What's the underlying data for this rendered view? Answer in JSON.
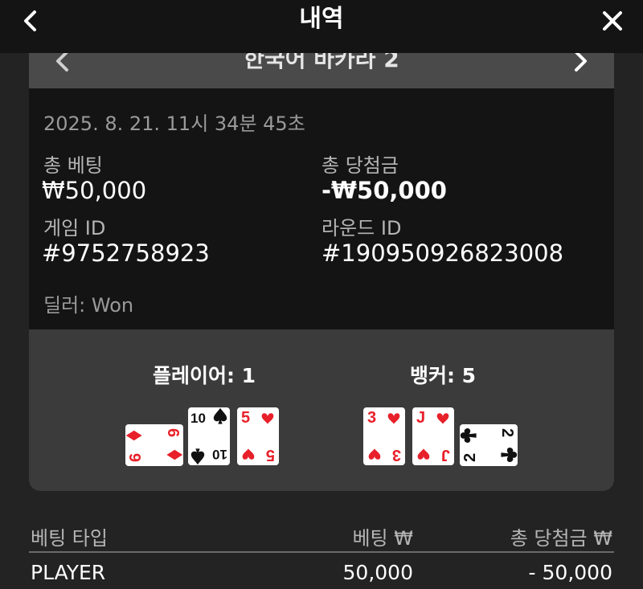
{
  "header": {
    "title": "내역",
    "back_icon": "chevron-left-icon",
    "close_icon": "close-icon"
  },
  "game_panel": {
    "game_name": "한국어 바카라 2",
    "prev_icon": "chevron-left-icon",
    "next_icon": "chevron-right-icon"
  },
  "details": {
    "timestamp": "2025. 8. 21. 11시 34분 45초",
    "total_bet_label": "총 베팅",
    "total_bet_value": "₩50,000",
    "total_win_label": "총 당첨금",
    "total_win_value": "-₩50,000",
    "game_id_label": "게임 ID",
    "game_id_value": "#9752758923",
    "round_id_label": "라운드 ID",
    "round_id_value": "#190950926823008",
    "dealer": "딜러: Won"
  },
  "result": {
    "player_label": "플레이어: 1",
    "banker_label": "뱅커: 5",
    "player_cards": [
      {
        "rank": "6",
        "suit": "diamond",
        "color": "#e8202a",
        "orientation": "side"
      },
      {
        "rank": "10",
        "suit": "spade",
        "color": "#111111",
        "orientation": "upright"
      },
      {
        "rank": "5",
        "suit": "heart",
        "color": "#e8202a",
        "orientation": "upright"
      }
    ],
    "banker_cards": [
      {
        "rank": "3",
        "suit": "heart",
        "color": "#e8202a",
        "orientation": "upright"
      },
      {
        "rank": "J",
        "suit": "heart",
        "color": "#e8202a",
        "orientation": "upright"
      },
      {
        "rank": "2",
        "suit": "club",
        "color": "#111111",
        "orientation": "side"
      }
    ]
  },
  "bets": {
    "columns": [
      "베팅 타입",
      "베팅 ₩",
      "총 당첨금 ₩"
    ],
    "rows": [
      {
        "type": "PLAYER",
        "bet": "50,000",
        "win": "- 50,000"
      }
    ]
  },
  "colors": {
    "background": "#232323",
    "top_bar": "#141414",
    "card_panel": "#3b3b3b",
    "details_panel": "#141414",
    "red_suit": "#e8202a",
    "black_suit": "#111111"
  }
}
